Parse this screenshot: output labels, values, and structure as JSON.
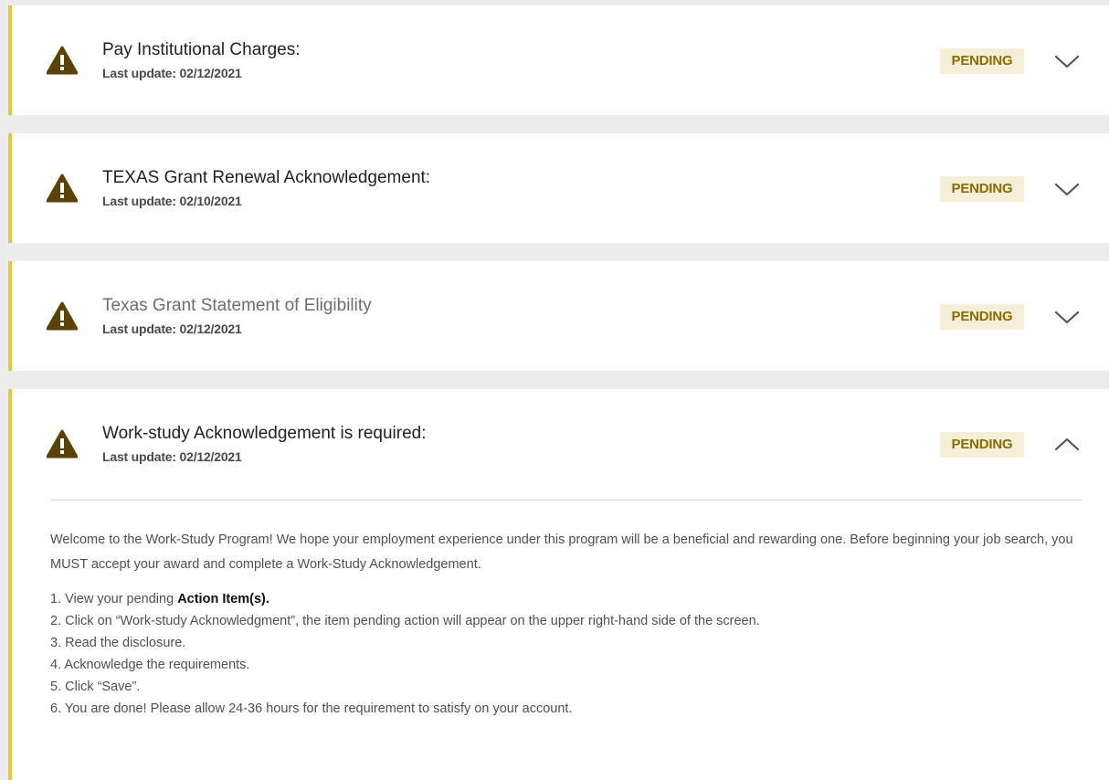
{
  "colors": {
    "accent_border": "#e8c83a",
    "warning_icon": "#5a4306",
    "badge_bg": "#f5efd9",
    "badge_text": "#8a6d00"
  },
  "items": [
    {
      "title": "Pay Institutional Charges:",
      "last_update": "Last update: 02/12/2021",
      "status": "PENDING",
      "icon": "warning-icon",
      "expanded": false
    },
    {
      "title": "TEXAS Grant Renewal Acknowledgement:",
      "last_update": "Last update: 02/10/2021",
      "status": "PENDING",
      "icon": "warning-icon",
      "expanded": false
    },
    {
      "title": "Texas Grant Statement of Eligibility",
      "last_update": "Last update: 02/12/2021",
      "status": "PENDING",
      "icon": "warning-icon",
      "expanded": false
    },
    {
      "title": "Work-study Acknowledgement is required:",
      "last_update": "Last update: 02/12/2021",
      "status": "PENDING",
      "icon": "warning-icon",
      "expanded": true,
      "details": {
        "intro": "Welcome to the Work-Study Program! We hope your employment experience under this program will be a beneficial and rewarding one. Before beginning your job search, you MUST accept your award and complete a Work-Study Acknowledgement.",
        "step1_prefix": "1. View your pending ",
        "step1_link": "Action Item(s).",
        "steps": [
          "2. Click on “Work-study Acknowledgment”, the item pending action will appear on the upper right-hand side of the screen.",
          "3. Read the disclosure.",
          "4. Acknowledge the requirements.",
          "5. Click “Save”.",
          "6. You are done! Please allow 24-36 hours for the requirement to satisfy on your account."
        ]
      }
    }
  ]
}
